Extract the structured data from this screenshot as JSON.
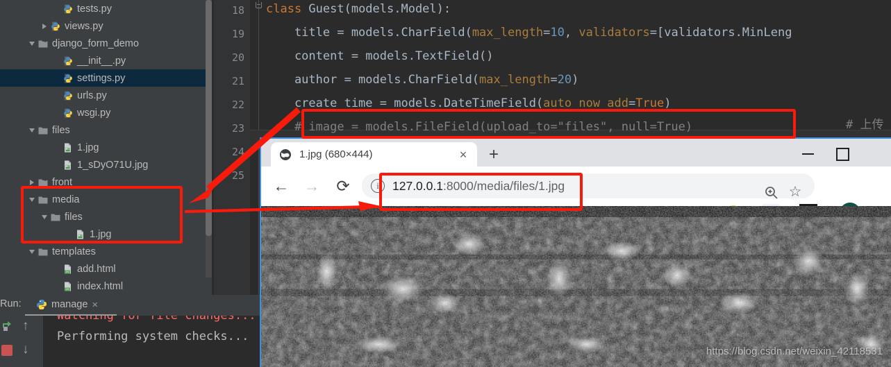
{
  "ide": {
    "tree": {
      "items": [
        {
          "label": "tests.py",
          "indent": 4,
          "toggle": "none",
          "icon": "python-file-icon",
          "selected": false
        },
        {
          "label": "views.py",
          "indent": 3,
          "toggle": "closed",
          "icon": "python-file-icon",
          "selected": false
        },
        {
          "label": "django_form_demo",
          "indent": 2,
          "toggle": "open",
          "icon": "module-folder-icon",
          "selected": false
        },
        {
          "label": "__init__.py",
          "indent": 4,
          "toggle": "none",
          "icon": "python-file-icon",
          "selected": false
        },
        {
          "label": "settings.py",
          "indent": 4,
          "toggle": "none",
          "icon": "python-file-icon",
          "selected": true
        },
        {
          "label": "urls.py",
          "indent": 4,
          "toggle": "none",
          "icon": "python-file-icon",
          "selected": false
        },
        {
          "label": "wsgi.py",
          "indent": 4,
          "toggle": "none",
          "icon": "python-file-icon",
          "selected": false
        },
        {
          "label": "files",
          "indent": 2,
          "toggle": "open",
          "icon": "folder-icon",
          "selected": false
        },
        {
          "label": "1.jpg",
          "indent": 4,
          "toggle": "none",
          "icon": "image-file-icon",
          "selected": false
        },
        {
          "label": "1_sDyO71U.jpg",
          "indent": 4,
          "toggle": "none",
          "icon": "image-file-icon",
          "selected": false
        },
        {
          "label": "front",
          "indent": 2,
          "toggle": "closed",
          "icon": "module-folder-icon",
          "selected": false
        },
        {
          "label": "media",
          "indent": 2,
          "toggle": "open",
          "icon": "folder-icon",
          "selected": false
        },
        {
          "label": "files",
          "indent": 3,
          "toggle": "open",
          "icon": "folder-icon",
          "selected": false
        },
        {
          "label": "1.jpg",
          "indent": 5,
          "toggle": "none",
          "icon": "image-file-icon",
          "selected": false
        },
        {
          "label": "templates",
          "indent": 2,
          "toggle": "open",
          "icon": "folder-icon",
          "selected": false
        },
        {
          "label": "add.html",
          "indent": 4,
          "toggle": "none",
          "icon": "html-file-icon",
          "selected": false
        },
        {
          "label": "index.html",
          "indent": 4,
          "toggle": "none",
          "icon": "html-file-icon",
          "selected": false
        }
      ]
    },
    "editor": {
      "line_numbers": [
        "18",
        "19",
        "20",
        "21",
        "22",
        "23",
        "24",
        "25"
      ],
      "lines": [
        {
          "n": "18",
          "tokens": [
            {
              "t": "class ",
              "c": "k-kw"
            },
            {
              "t": "Guest(models.Model):",
              "c": "k-plain"
            }
          ]
        },
        {
          "n": "19",
          "tokens": [
            {
              "t": "    title = models.CharField(",
              "c": "k-plain"
            },
            {
              "t": "max_length",
              "c": "k-param"
            },
            {
              "t": "=",
              "c": "k-plain"
            },
            {
              "t": "10",
              "c": "k-num"
            },
            {
              "t": ", ",
              "c": "k-plain"
            },
            {
              "t": "validators",
              "c": "k-param"
            },
            {
              "t": "=[validators.MinLeng",
              "c": "k-plain"
            }
          ]
        },
        {
          "n": "20",
          "tokens": [
            {
              "t": "    content = models.TextField()",
              "c": "k-plain"
            }
          ]
        },
        {
          "n": "21",
          "tokens": [
            {
              "t": "    author = models.CharField(",
              "c": "k-plain"
            },
            {
              "t": "max_length",
              "c": "k-param"
            },
            {
              "t": "=",
              "c": "k-plain"
            },
            {
              "t": "20",
              "c": "k-num"
            },
            {
              "t": ")",
              "c": "k-plain"
            }
          ]
        },
        {
          "n": "22",
          "tokens": [
            {
              "t": "    create_time = models.DateTimeField(",
              "c": "k-plain"
            },
            {
              "t": "auto_now_add",
              "c": "k-param"
            },
            {
              "t": "=",
              "c": "k-plain"
            },
            {
              "t": "True",
              "c": "k-kw"
            },
            {
              "t": ")",
              "c": "k-plain"
            }
          ]
        },
        {
          "n": "23",
          "tokens": [
            {
              "t": "    # image = models.FileField(upload_to=\"files\", null=True)",
              "c": "k-comment"
            }
          ]
        }
      ],
      "trailing_comment": "# 上传"
    },
    "run": {
      "label": "Run:",
      "tab_title": "manage",
      "tab_close": "×",
      "console_lines": [
        {
          "text": "Watching for file changes...",
          "cls": "c-red"
        },
        {
          "text": "Performing system checks...",
          "cls": "c-gray"
        }
      ]
    }
  },
  "browser": {
    "tab": {
      "title": "1.jpg (680×444)",
      "close": "×",
      "favicon": "globe-icon"
    },
    "new_tab": "+",
    "window_controls": {
      "minimize": "minimize-icon",
      "maximize": "maximize-icon"
    },
    "nav": {
      "back": "←",
      "forward": "→",
      "reload": "⟳"
    },
    "omnibox": {
      "info_glyph": "ⓘ",
      "url_host": "127.0.0.1",
      "url_rest": ":8000/media/files/1.jpg",
      "full_url": "127.0.0.1:8000/media/files/1.jpg"
    },
    "toolbar_icons": [
      "zoom-in-icon",
      "bookmark-star-icon",
      "extension-green-icon",
      "extension-blue-bird-icon",
      "extension-astar-icon",
      "profile-avatar-icon"
    ],
    "content": {
      "watermark": "https://blog.csdn.net/weixin_42118531"
    }
  },
  "annotations": {
    "color": "#f81b0b",
    "boxes": [
      {
        "name": "code-comment-highlight"
      },
      {
        "name": "media-folder-highlight"
      },
      {
        "name": "url-highlight"
      }
    ],
    "arrows": [
      {
        "name": "comment-to-media-arrow"
      },
      {
        "name": "media-to-url-arrow"
      }
    ]
  }
}
